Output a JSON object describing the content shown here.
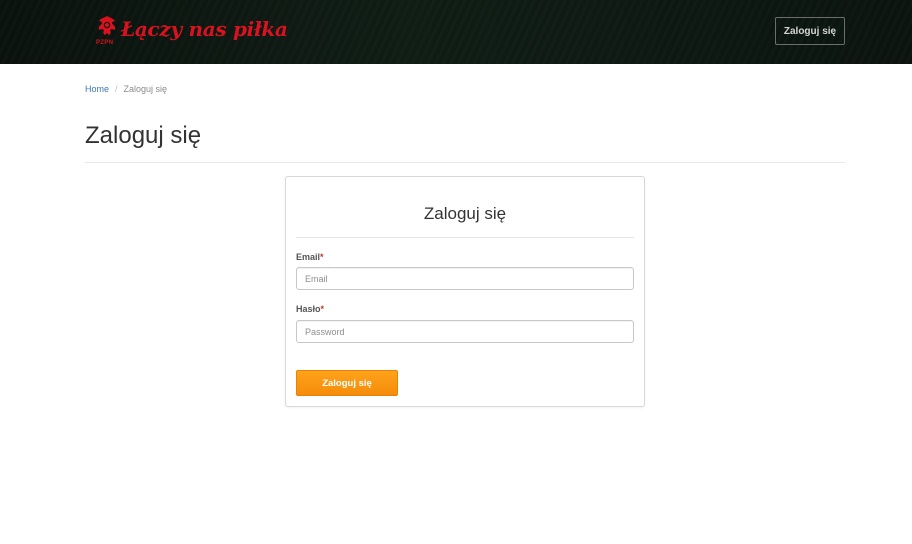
{
  "header": {
    "logo_text": "Łączy nas piłka",
    "logo_badge": "PZPN",
    "login_button": "Zaloguj się"
  },
  "breadcrumb": {
    "home": "Home",
    "separator": "/",
    "current": "Zaloguj się"
  },
  "page": {
    "title": "Zaloguj się"
  },
  "login_form": {
    "title": "Zaloguj się",
    "email_label": "Email",
    "email_required": "*",
    "email_placeholder": "Email",
    "password_label": "Hasło",
    "password_required": "*",
    "password_placeholder": "Password",
    "submit_label": "Zaloguj się"
  },
  "colors": {
    "header_bg": "#0b140f",
    "brand_red": "#d9121f",
    "accent_orange": "#f7920f",
    "link_blue": "#3c78b4"
  },
  "icons": {
    "logo_emblem": "pzpn-eagle-emblem-icon"
  }
}
